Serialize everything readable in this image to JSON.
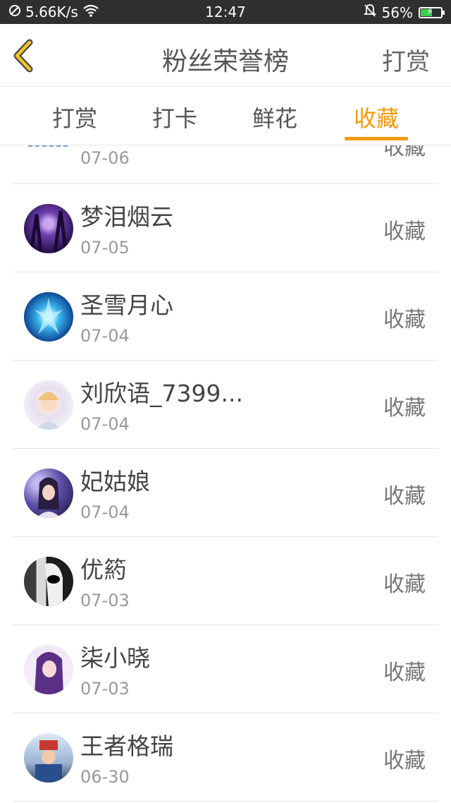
{
  "status_bar": {
    "net_speed": "5.66K/s",
    "time": "12:47",
    "battery": "56%",
    "battery_level": 0.56
  },
  "header": {
    "title": "粉丝荣誉榜",
    "action": "打赏"
  },
  "tabs": [
    {
      "label": "打赏"
    },
    {
      "label": "打卡"
    },
    {
      "label": "鲜花"
    },
    {
      "label": "收藏",
      "active": true
    }
  ],
  "colors": {
    "accent": "#f59a0a"
  },
  "list": {
    "partial": {
      "date": "07-06",
      "action": "收藏"
    },
    "items": [
      {
        "name": "梦泪烟云",
        "date": "07-05",
        "action": "收藏"
      },
      {
        "name": "圣雪月心",
        "date": "07-04",
        "action": "收藏"
      },
      {
        "name": "刘欣语_7399...",
        "date": "07-04",
        "action": "收藏"
      },
      {
        "name": "妃姑娘",
        "date": "07-04",
        "action": "收藏"
      },
      {
        "name": "优箹",
        "date": "07-03",
        "action": "收藏"
      },
      {
        "name": "柒小晓",
        "date": "07-03",
        "action": "收藏"
      },
      {
        "name": "王者格瑞",
        "date": "06-30",
        "action": "收藏"
      }
    ]
  }
}
